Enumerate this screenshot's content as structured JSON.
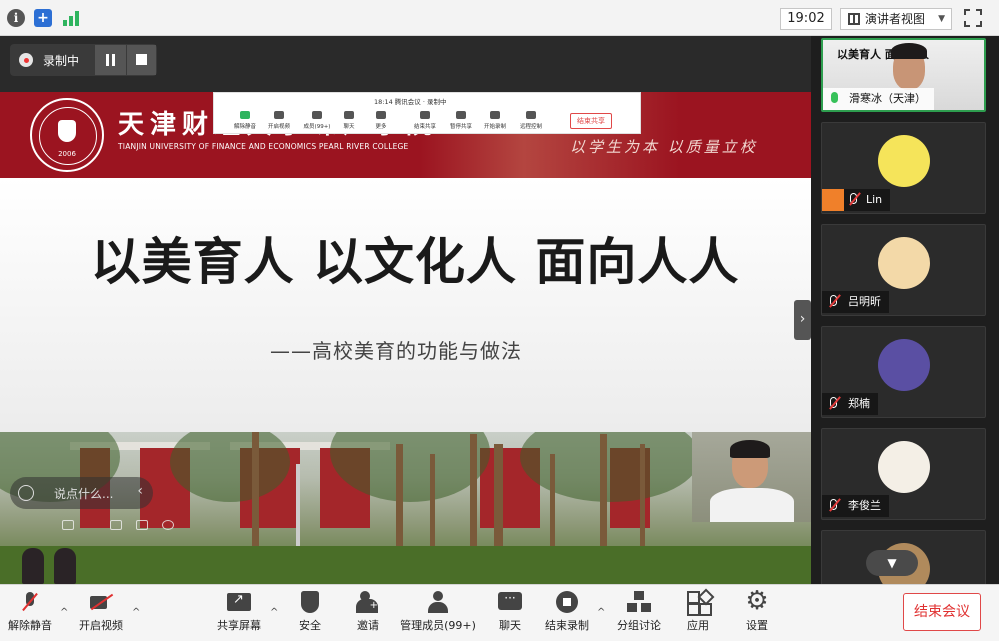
{
  "topbar": {
    "time": "19:02",
    "view_mode": "演讲者视图"
  },
  "recording": {
    "label": "录制中"
  },
  "slide": {
    "school_cn": "天津财经大学珠江学院",
    "school_en": "TIANJIN UNIVERSITY OF FINANCE AND ECONOMICS PEARL RIVER COLLEGE",
    "emblem_year": "2006",
    "motto": "以学生为本  以质量立校",
    "title": "以美育人  以文化人  面向人人",
    "subtitle": "——高校美育的功能与做法"
  },
  "float_toolbar": {
    "status": "18:14  腾讯会议  · 录制中",
    "items": [
      "解除静音",
      "开启视频",
      "成员(99+)",
      "聊天",
      "更多",
      "结束共享",
      "暂停共享",
      "开始录制",
      "远程控制"
    ],
    "end_label": "结束共享"
  },
  "chat": {
    "placeholder": "说点什么..."
  },
  "participants": [
    {
      "name": "滑寒冰（天津）",
      "mic": "live",
      "video": true,
      "snippet": "以美育人  面向人人"
    },
    {
      "name": "Lin",
      "mic": "muted",
      "avatar_color": "#f5e45a"
    },
    {
      "name": "吕明昕",
      "mic": "muted",
      "avatar_color": "#f3d9a8"
    },
    {
      "name": "郑楠",
      "mic": "muted",
      "avatar_color": "#5a4fa3"
    },
    {
      "name": "李俊兰",
      "mic": "muted",
      "avatar_color": "#f4efe6"
    }
  ],
  "bottom_toolbar": {
    "unmute": "解除静音",
    "start_video": "开启视频",
    "share_screen": "共享屏幕",
    "security": "安全",
    "invite": "邀请",
    "manage_members": "管理成员(99+)",
    "chat": "聊天",
    "end_recording": "结束录制",
    "breakout": "分组讨论",
    "apps": "应用",
    "settings": "设置",
    "end_meeting": "结束会议"
  }
}
